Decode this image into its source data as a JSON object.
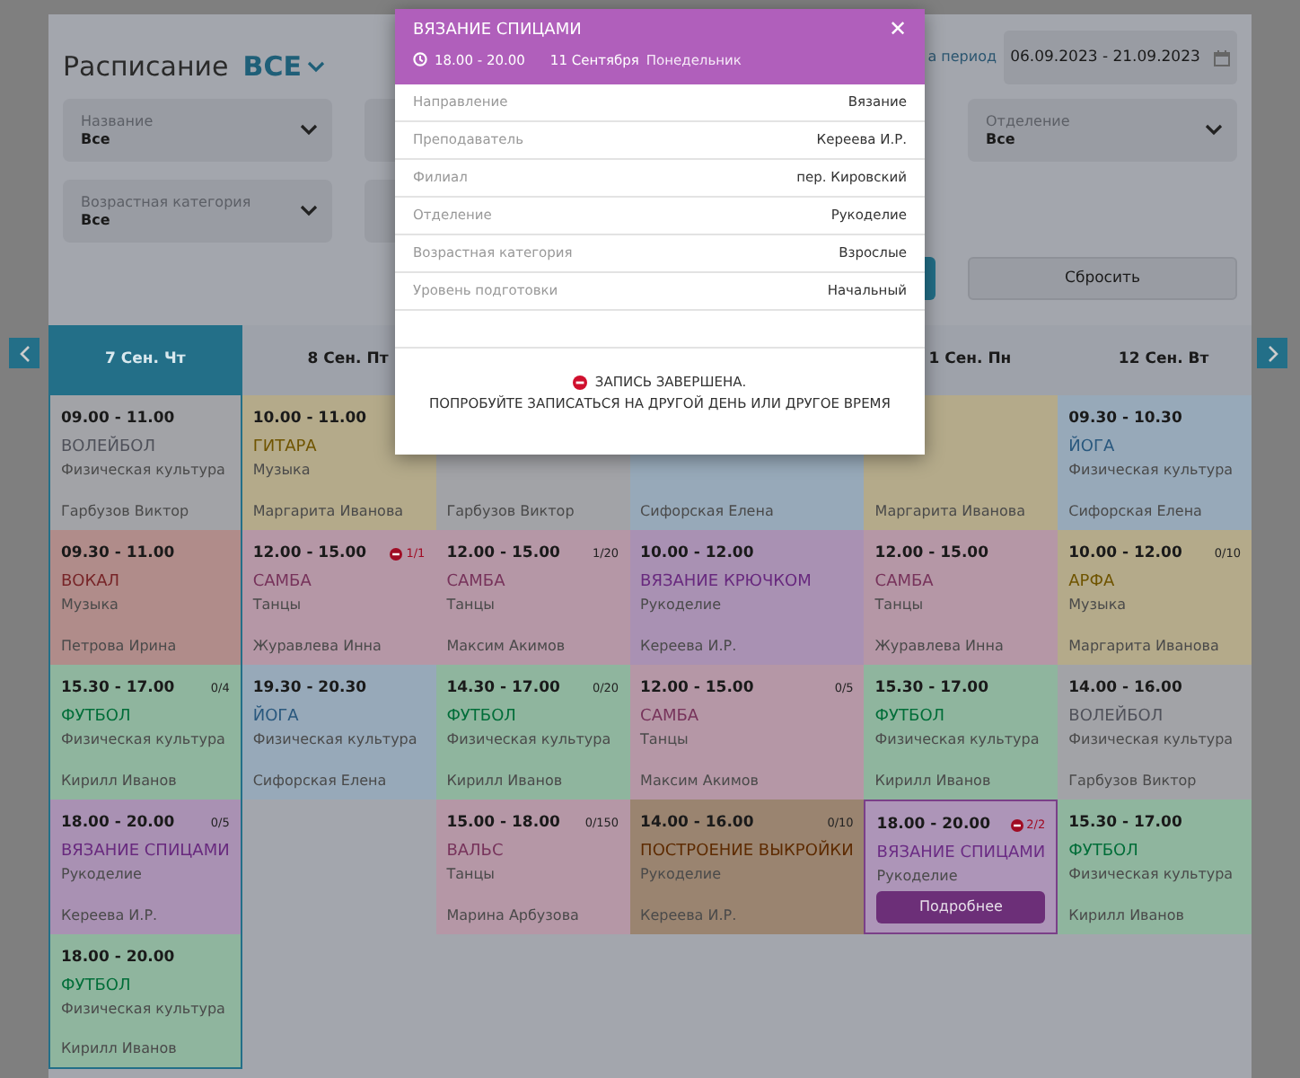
{
  "header": {
    "title": "Расписание",
    "scope": "ВСЕ",
    "period_label": "а период",
    "period": "06.09.2023 - 21.09.2023"
  },
  "filters": [
    {
      "label": "Название",
      "value": "Все"
    },
    {
      "label": "Отделение",
      "value": "Все"
    },
    {
      "label": "Возрастная категория",
      "value": "Все"
    }
  ],
  "reset_button": "Сбросить",
  "columns": [
    {
      "header": "7 Сен. Чт",
      "selected": true,
      "cells": [
        {
          "time": "09.00 - 11.00",
          "name": "ВОЛЕЙБОЛ",
          "color": "#a2a3a7",
          "subject": "Физическая культура",
          "teacher": "Гарбузов Виктор",
          "hovered": false
        },
        {
          "time": "09.30 - 11.00",
          "name": "ВОКАЛ",
          "color": "#b08c8a",
          "subject": "Музыка",
          "teacher": "Петрова Ирина",
          "hovered": false
        },
        {
          "time": "15.30 - 17.00",
          "count": "0/4",
          "full": false,
          "name": "ФУТБОЛ",
          "color": "#8fb59e",
          "subject": "Физическая культура",
          "teacher": "Кирилл Иванов",
          "hovered": false
        },
        {
          "time": "18.00 - 20.00",
          "count": "0/5",
          "full": false,
          "name": "ВЯЗАНИЕ СПИЦАМИ",
          "color": "#a991b3",
          "subject": "Рукоделие",
          "teacher": "Кереева И.Р.",
          "hovered": false
        },
        {
          "time": "18.00 - 20.00",
          "name": "ФУТБОЛ",
          "color": "#8fb59e",
          "subject": "Физическая культура",
          "teacher": "Кирилл Иванов",
          "hovered": false
        }
      ]
    },
    {
      "header": "8 Сен. Пт",
      "selected": false,
      "cells": [
        {
          "time": "10.00 - 11.00",
          "name": "ГИТАРА",
          "color": "#b4aa8a",
          "subject": "Музыка",
          "teacher": "Маргарита Иванова",
          "hovered": false
        },
        {
          "time": "12.00 - 15.00",
          "count": "1/1",
          "full": true,
          "name": "САМБА",
          "color": "#b597a6",
          "subject": "Танцы",
          "teacher": "Журавлева Инна",
          "hovered": false
        },
        {
          "time": "19.30 - 20.30",
          "name": "ЙОГА",
          "color": "#97a9b9",
          "subject": "Физическая культура",
          "teacher": "Сифорская Елена",
          "hovered": false
        }
      ]
    },
    {
      "selected": false,
      "cells": [
        {
          "color": "#a2a3a7",
          "teacher": "Гарбузов Виктор",
          "hovered": false
        },
        {
          "time": "12.00 - 15.00",
          "count": "1/20",
          "full": false,
          "name": "САМБА",
          "color": "#b597a6",
          "subject": "Танцы",
          "teacher": "Максим Акимов",
          "hovered": false
        },
        {
          "time": "14.30 - 17.00",
          "count": "0/20",
          "full": false,
          "name": "ФУТБОЛ",
          "color": "#8fb59e",
          "subject": "Физическая культура",
          "teacher": "Кирилл Иванов",
          "hovered": false
        },
        {
          "time": "15.00 - 18.00",
          "count": "0/150",
          "full": false,
          "name": "ВАЛЬС",
          "color": "#b597a6",
          "subject": "Танцы",
          "teacher": "Марина Арбузова",
          "hovered": false
        }
      ]
    },
    {
      "selected": false,
      "cells": [
        {
          "color": "#97a9b9",
          "teacher": "Сифорская Елена",
          "hovered": false
        },
        {
          "time": "10.00 - 12.00",
          "name": "ВЯЗАНИЕ КРЮЧКОМ",
          "color": "#a991b3",
          "subject": "Рукоделие",
          "teacher": "Кереева И.Р.",
          "hovered": false
        },
        {
          "time": "12.00 - 15.00",
          "count": "0/5",
          "full": false,
          "name": "САМБА",
          "color": "#b597a6",
          "subject": "Танцы",
          "teacher": "Максим Акимов",
          "hovered": false
        },
        {
          "time": "14.00 - 16.00",
          "count": "0/10",
          "full": false,
          "name": "ПОСТРОЕНИЕ ВЫКРОЙКИ",
          "color": "#9a8470",
          "subject": "Рукоделие",
          "teacher": "Кереева И.Р.",
          "hovered": false
        }
      ]
    },
    {
      "header": "1 Сен. Пн",
      "selected": false,
      "cells": [
        {
          "color": "#b4aa8a",
          "teacher": "Маргарита Иванова",
          "hovered": false
        },
        {
          "time": "12.00 - 15.00",
          "name": "САМБА",
          "color": "#b597a6",
          "subject": "Танцы",
          "teacher": "Журавлева Инна",
          "hovered": false
        },
        {
          "time": "15.30 - 17.00",
          "name": "ФУТБОЛ",
          "color": "#8fb59e",
          "subject": "Физическая культура",
          "teacher": "Кирилл Иванов",
          "hovered": false
        },
        {
          "time": "18.00 - 20.00",
          "count": "2/2",
          "full": true,
          "name": "ВЯЗАНИЕ СПИЦАМИ",
          "color": "#ad95b8",
          "subject": "Рукоделие",
          "button": "Подробнее",
          "hovered": true
        }
      ]
    },
    {
      "header": "12 Сен. Вт",
      "selected": false,
      "cells": [
        {
          "time": "09.30 - 10.30",
          "name": "ЙОГА",
          "color": "#97a9b9",
          "subject": "Физическая культура",
          "teacher": "Сифорская Елена",
          "hovered": false
        },
        {
          "time": "10.00 - 12.00",
          "count": "0/10",
          "full": false,
          "name": "АРФА",
          "color": "#b4aa8a",
          "subject": "Музыка",
          "teacher": "Маргарита Иванова",
          "hovered": false
        },
        {
          "time": "14.00 - 16.00",
          "name": "ВОЛЕЙБОЛ",
          "color": "#a2a3a7",
          "subject": "Физическая культура",
          "teacher": "Гарбузов Виктор",
          "hovered": false
        },
        {
          "time": "15.30 - 17.00",
          "name": "ФУТБОЛ",
          "color": "#8fb59e",
          "subject": "Физическая культура",
          "teacher": "Кирилл Иванов",
          "hovered": false
        }
      ]
    }
  ],
  "modal": {
    "title": "ВЯЗАНИЕ СПИЦАМИ",
    "close": "✕",
    "time": "18.00 - 20.00",
    "date": "11 Сентября",
    "weekday": "Понедельник",
    "rows": [
      {
        "label": "Направление",
        "value": "Вязание"
      },
      {
        "label": "Преподаватель",
        "value": "Кереева И.Р."
      },
      {
        "label": "Филиал",
        "value": "пер. Кировский"
      },
      {
        "label": "Отделение",
        "value": "Рукоделие"
      },
      {
        "label": "Возрастная категория",
        "value": "Взрослые"
      },
      {
        "label": "Уровень подготовки",
        "value": "Начальный"
      }
    ],
    "message": [
      "ЗАПИСЬ ЗАВЕРШЕНА.",
      "ПОПРОБУЙТЕ ЗАПИСАТЬСЯ НА ДРУГОЙ ДЕНЬ ИЛИ ДРУГОЕ ВРЕМЯ"
    ]
  }
}
